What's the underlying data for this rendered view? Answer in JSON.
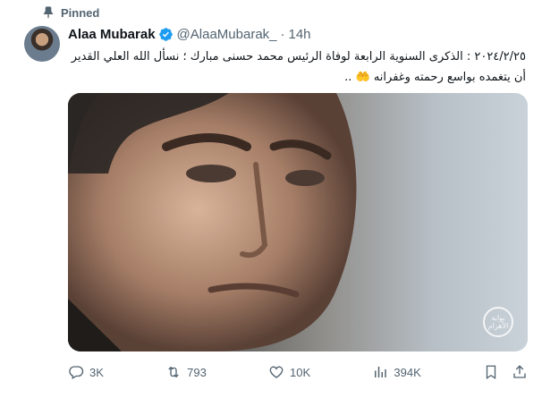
{
  "pinned": {
    "label": "Pinned",
    "icon": "pin-icon"
  },
  "author": {
    "name": "Alaa Mubarak",
    "handle": "@AlaaMubarak_",
    "separator": "·",
    "time": "14h",
    "verified_icon": "verified-badge-icon"
  },
  "tweet": {
    "text": "٢٠٢٤/٢/٢٥ : الذكرى السنوية  الرابعة لوفاة الرئيس محمد حسنى مبارك ؛ نسأل الله العلي القدير أن يتغمده بواسع رحمته وغفرانه 🤲 .."
  },
  "media": {
    "watermark": "بوابة الأهرام"
  },
  "actions": {
    "reply": {
      "icon": "reply-icon",
      "count": "3K"
    },
    "retweet": {
      "icon": "retweet-icon",
      "count": "793"
    },
    "like": {
      "icon": "like-icon",
      "count": "10K"
    },
    "views": {
      "icon": "views-icon",
      "count": "394K"
    },
    "bookmark": {
      "icon": "bookmark-icon"
    },
    "share": {
      "icon": "share-icon"
    }
  },
  "colors": {
    "text": "#0f1419",
    "muted": "#536471",
    "verified": "#1d9bf0"
  }
}
